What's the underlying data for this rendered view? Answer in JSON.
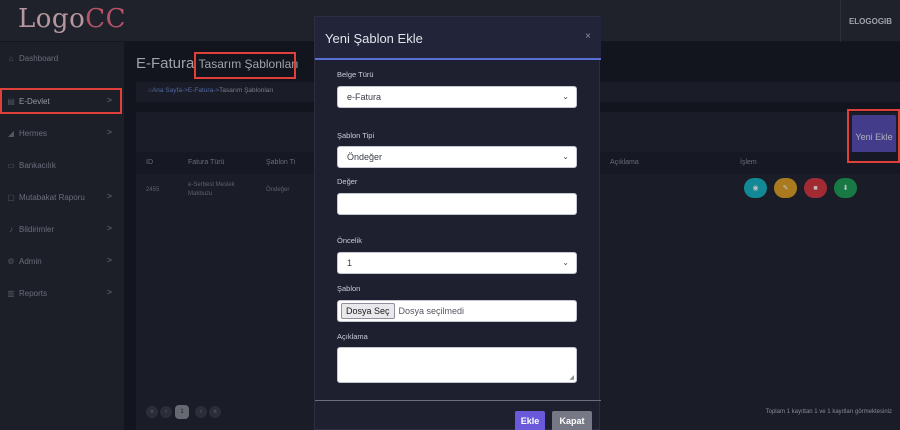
{
  "brand": {
    "logo_main": "Logo",
    "logo_accent": "CC"
  },
  "topbar": {
    "user": "ELOGOGIB"
  },
  "sidebar": {
    "items": [
      {
        "label": "Dashboard",
        "icon": "home-icon",
        "chevron": ""
      },
      {
        "label": "E-Devlet",
        "icon": "document-icon",
        "chevron": ">"
      },
      {
        "label": "Hermes",
        "icon": "send-icon",
        "chevron": ">"
      },
      {
        "label": "Bankacılık",
        "icon": "card-icon",
        "chevron": ""
      },
      {
        "label": "Mutabakat Raporu",
        "icon": "report-icon",
        "chevron": ">"
      },
      {
        "label": "Bildirimler",
        "icon": "bell-icon",
        "chevron": ">"
      },
      {
        "label": "Admin",
        "icon": "gear-icon",
        "chevron": ">"
      },
      {
        "label": "Reports",
        "icon": "chart-icon",
        "chevron": ">"
      }
    ]
  },
  "page": {
    "title_main": "E-Fatura",
    "title_sub": "Tasarım Şablonları",
    "breadcrumb": {
      "home": "Ana Sayfa",
      "sep1": "->",
      "mid": "E-Fatura",
      "sep2": "->",
      "current": "Tasarım Şablonları"
    },
    "new_button": "Yeni Ekle"
  },
  "table": {
    "columns": [
      "ID",
      "Fatura Türü",
      "Şablon Ti",
      "Açıklama",
      "İşlem"
    ],
    "rows": [
      {
        "id": "2455",
        "fatura_turu": "e-Serbest Meslek Makbuzu",
        "sablon_tipi": "Öndeğer"
      }
    ],
    "actions": [
      {
        "name": "view",
        "icon": "eye-icon",
        "glyph": "◉",
        "color": "#1ab7c8"
      },
      {
        "name": "edit",
        "icon": "edit-icon",
        "glyph": "✎",
        "color": "#e3a529"
      },
      {
        "name": "delete",
        "icon": "trash-icon",
        "glyph": "■",
        "color": "#d93a45"
      },
      {
        "name": "download",
        "icon": "download-icon",
        "glyph": "⬇",
        "color": "#1fa35c"
      }
    ]
  },
  "pagination": {
    "first": "«",
    "prev": "‹",
    "current": "1",
    "next": "›",
    "last": "»"
  },
  "footer": {
    "summary": "Toplam 1 kayıttan 1 ve 1 kayıtları görmektesiniz"
  },
  "modal": {
    "title": "Yeni Şablon Ekle",
    "close": "×",
    "fields": {
      "belge_turu": {
        "label": "Belge Türü",
        "value": "e-Fatura"
      },
      "sablon_tipi": {
        "label": "Şablon Tipi",
        "value": "Öndeğer"
      },
      "deger": {
        "label": "Değer",
        "value": ""
      },
      "oncelik": {
        "label": "Öncelik",
        "value": "1"
      },
      "sablon": {
        "label": "Şablon",
        "button": "Dosya Seç",
        "status": "Dosya seçilmedi"
      },
      "aciklama": {
        "label": "Açıklama",
        "value": ""
      }
    },
    "buttons": {
      "add": "Ekle",
      "close": "Kapat"
    }
  },
  "colors": {
    "accent": "#5a50b8",
    "highlight": "#e0403a",
    "header_line": "#5a6fd6"
  }
}
